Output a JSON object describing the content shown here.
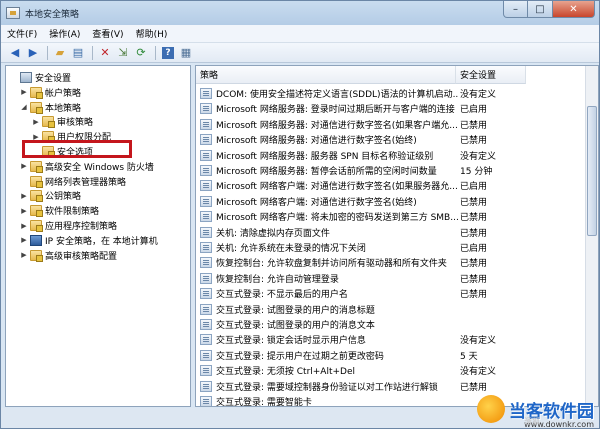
{
  "window": {
    "title": "本地安全策略"
  },
  "menu": [
    "文件(F)",
    "操作(A)",
    "查看(V)",
    "帮助(H)"
  ],
  "tree": [
    {
      "label": "安全设置",
      "icon": "computer-icon",
      "expander": "",
      "level": 0
    },
    {
      "label": "帐户策略",
      "icon": "folder-icon",
      "expander": "▶",
      "level": 1
    },
    {
      "label": "本地策略",
      "icon": "folder-icon",
      "expander": "◢",
      "level": 1
    },
    {
      "label": "审核策略",
      "icon": "folder-icon",
      "expander": "▶",
      "level": 2
    },
    {
      "label": "用户权限分配",
      "icon": "folder-icon",
      "expander": "▶",
      "level": 2
    },
    {
      "label": "安全选项",
      "icon": "folder-icon",
      "expander": "",
      "level": 2
    },
    {
      "label": "高级安全 Windows 防火墙",
      "icon": "folder-icon",
      "expander": "▶",
      "level": 1
    },
    {
      "label": "网络列表管理器策略",
      "icon": "folder-icon",
      "expander": "",
      "level": 1
    },
    {
      "label": "公钥策略",
      "icon": "folder-icon",
      "expander": "▶",
      "level": 1
    },
    {
      "label": "软件限制策略",
      "icon": "folder-icon",
      "expander": "▶",
      "level": 1
    },
    {
      "label": "应用程序控制策略",
      "icon": "folder-icon",
      "expander": "▶",
      "level": 1
    },
    {
      "label": "IP 安全策略，在 本地计算机",
      "icon": "ipsec-icon",
      "expander": "▶",
      "level": 1
    },
    {
      "label": "高级审核策略配置",
      "icon": "folder-icon",
      "expander": "▶",
      "level": 1
    }
  ],
  "list": {
    "headers": {
      "policy": "策略",
      "setting": "安全设置"
    },
    "rows": [
      {
        "policy": "DCOM: 使用安全描述符定义语言(SDDL)语法的计算机启动...",
        "setting": "没有定义"
      },
      {
        "policy": "Microsoft 网络服务器: 登录时间过期后断开与客户端的连接",
        "setting": "已启用"
      },
      {
        "policy": "Microsoft 网络服务器: 对通信进行数字签名(如果客户端允...",
        "setting": "已禁用"
      },
      {
        "policy": "Microsoft 网络服务器: 对通信进行数字签名(始终)",
        "setting": "已禁用"
      },
      {
        "policy": "Microsoft 网络服务器: 服务器 SPN 目标名称验证级别",
        "setting": "没有定义"
      },
      {
        "policy": "Microsoft 网络服务器: 暂停会话前所需的空闲时间数量",
        "setting": "15 分钟"
      },
      {
        "policy": "Microsoft 网络客户端: 对通信进行数字签名(如果服务器允...",
        "setting": "已启用"
      },
      {
        "policy": "Microsoft 网络客户端: 对通信进行数字签名(始终)",
        "setting": "已禁用"
      },
      {
        "policy": "Microsoft 网络客户端: 将未加密的密码发送到第三方 SMB...",
        "setting": "已禁用"
      },
      {
        "policy": "关机: 清除虚拟内存页面文件",
        "setting": "已禁用"
      },
      {
        "policy": "关机: 允许系统在未登录的情况下关闭",
        "setting": "已启用"
      },
      {
        "policy": "恢复控制台: 允许软盘复制并访问所有驱动器和所有文件夹",
        "setting": "已禁用"
      },
      {
        "policy": "恢复控制台: 允许自动管理登录",
        "setting": "已禁用"
      },
      {
        "policy": "交互式登录: 不显示最后的用户名",
        "setting": "已禁用"
      },
      {
        "policy": "交互式登录: 试图登录的用户的消息标题",
        "setting": ""
      },
      {
        "policy": "交互式登录: 试图登录的用户的消息文本",
        "setting": ""
      },
      {
        "policy": "交互式登录: 锁定会话时显示用户信息",
        "setting": "没有定义"
      },
      {
        "policy": "交互式登录: 提示用户在过期之前更改密码",
        "setting": "5 天"
      },
      {
        "policy": "交互式登录: 无须按 Ctrl+Alt+Del",
        "setting": "没有定义"
      },
      {
        "policy": "交互式登录: 需要域控制器身份验证以对工作站进行解锁",
        "setting": "已禁用"
      },
      {
        "policy": "交互式登录: 需要智能卡",
        "setting": ""
      }
    ]
  },
  "watermark": {
    "brand": "当客软件园",
    "url": "www.downkr.com",
    "sub": "溜狐"
  },
  "colors": {
    "highlight_box": "#c4161c",
    "window_frame": "#d9e6f3"
  }
}
